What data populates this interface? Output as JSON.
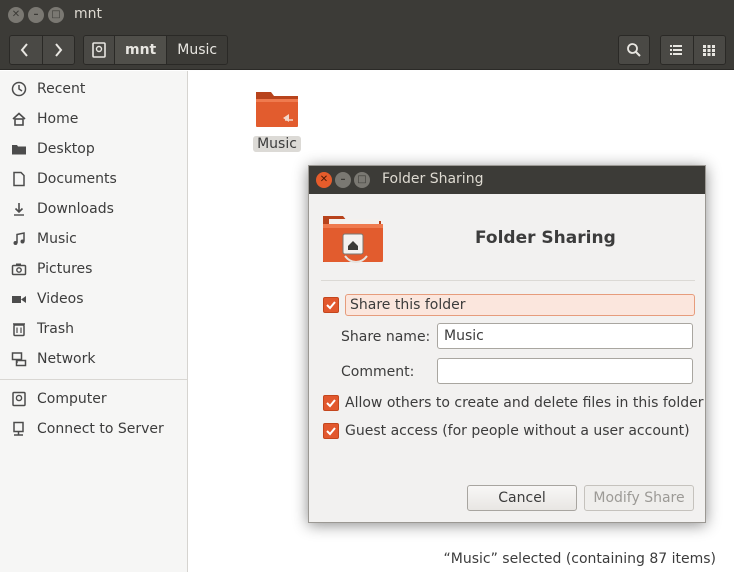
{
  "window": {
    "title": "mnt"
  },
  "toolbar": {
    "path": [
      "mnt",
      "Music"
    ]
  },
  "sidebar": {
    "items": [
      {
        "label": "Recent",
        "icon": "clock-icon"
      },
      {
        "label": "Home",
        "icon": "home-icon"
      },
      {
        "label": "Desktop",
        "icon": "desktop-folder-icon"
      },
      {
        "label": "Documents",
        "icon": "document-icon"
      },
      {
        "label": "Downloads",
        "icon": "download-icon"
      },
      {
        "label": "Music",
        "icon": "music-note-icon"
      },
      {
        "label": "Pictures",
        "icon": "camera-icon"
      },
      {
        "label": "Videos",
        "icon": "video-icon"
      },
      {
        "label": "Trash",
        "icon": "trash-icon"
      },
      {
        "label": "Network",
        "icon": "network-icon"
      }
    ],
    "devices": [
      {
        "label": "Computer",
        "icon": "drive-icon"
      },
      {
        "label": "Connect to Server",
        "icon": "server-icon"
      }
    ]
  },
  "content": {
    "folder_label": "Music",
    "status": "“Music” selected  (containing 87 items)"
  },
  "dialog": {
    "title": "Folder Sharing",
    "heading": "Folder Sharing",
    "share_checkbox": {
      "label": "Share this folder",
      "checked": true
    },
    "share_name_label": "Share name:",
    "share_name_value": "Music",
    "comment_label": "Comment:",
    "comment_value": "",
    "allow_others": {
      "label": "Allow others to create and delete files in this folder",
      "checked": true
    },
    "guest_access": {
      "label": "Guest access (for people without a user account)",
      "checked": true
    },
    "cancel_label": "Cancel",
    "modify_label": "Modify Share"
  },
  "colors": {
    "accent": "#e2582e",
    "titlebar": "#3c3b37",
    "folder": "#e05a2d"
  }
}
